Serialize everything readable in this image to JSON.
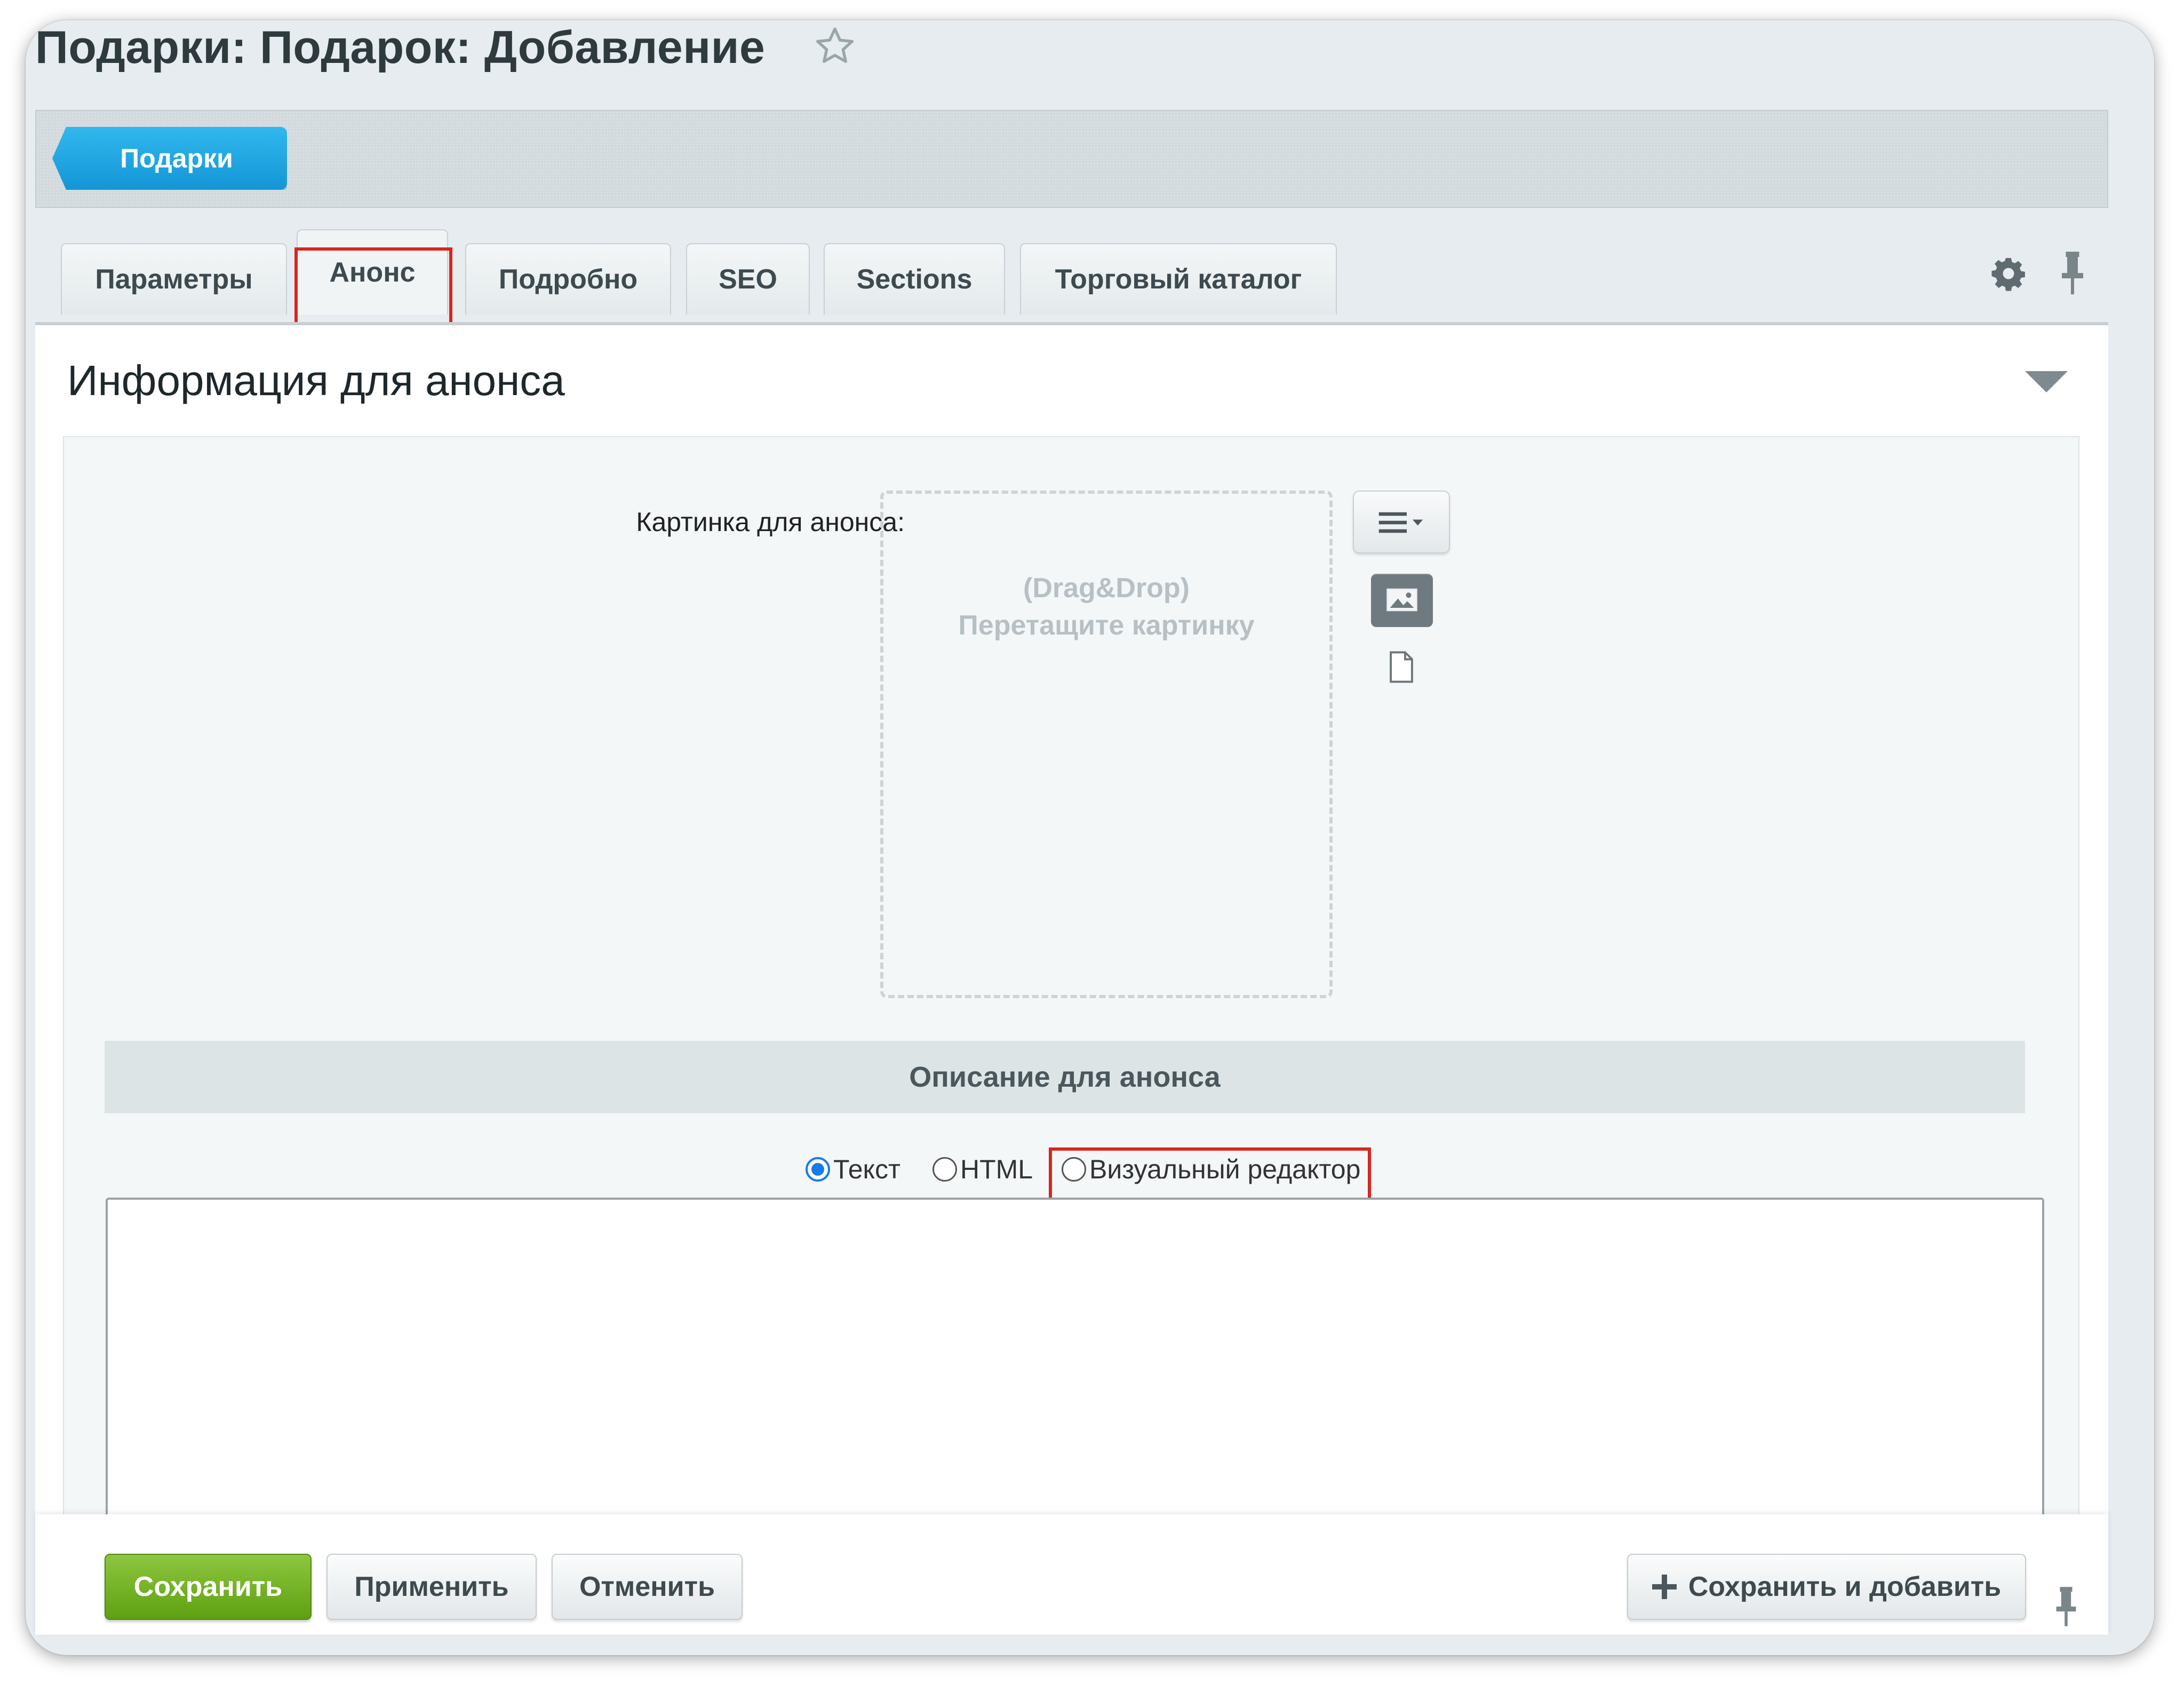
{
  "window": {
    "title": "Подарки: Подарок: Добавление"
  },
  "breadcrumb": {
    "label": "Подарки"
  },
  "tabs": [
    {
      "label": "Параметры",
      "active": false
    },
    {
      "label": "Анонс",
      "active": true
    },
    {
      "label": "Подробно",
      "active": false
    },
    {
      "label": "SEO",
      "active": false
    },
    {
      "label": "Sections",
      "active": false
    },
    {
      "label": "Торговый каталог",
      "active": false
    }
  ],
  "section": {
    "title": "Информация для анонса"
  },
  "image_field": {
    "label": "Картинка для анонса:",
    "dropzone_line1": "(Drag&Drop)",
    "dropzone_line2": "Перетащите картинку"
  },
  "description": {
    "header": "Описание для анонса",
    "modes": [
      {
        "label": "Текст",
        "selected": true
      },
      {
        "label": "HTML",
        "selected": false
      },
      {
        "label": "Визуальный редактор",
        "selected": false
      }
    ],
    "value": ""
  },
  "footer": {
    "save": "Сохранить",
    "apply": "Применить",
    "cancel": "Отменить",
    "save_and_add": "Сохранить и добавить"
  },
  "colors": {
    "highlight": "#d9261c",
    "accent_blue": "#1a96d6",
    "save_green": "#6aae1c"
  }
}
